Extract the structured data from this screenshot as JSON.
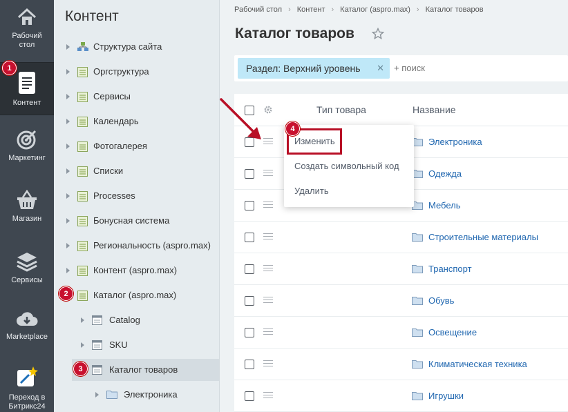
{
  "leftnav": {
    "items": [
      {
        "label": "Рабочий стол",
        "icon": "home-icon"
      },
      {
        "label": "Контент",
        "icon": "document-icon",
        "active": true
      },
      {
        "label": "Маркетинг",
        "icon": "target-icon"
      },
      {
        "label": "Магазин",
        "icon": "basket-icon"
      },
      {
        "label": "Сервисы",
        "icon": "layers-icon"
      },
      {
        "label": "Marketplace",
        "icon": "cloud-download-icon"
      },
      {
        "label": "Переход в Битрикс24",
        "icon": "magic-wand-icon"
      }
    ]
  },
  "badges": {
    "b1": "1",
    "b2": "2",
    "b3": "3",
    "b4": "4"
  },
  "tree": {
    "title": "Контент",
    "items": [
      {
        "label": "Структура сайта",
        "icon": "site-structure-icon"
      },
      {
        "label": "Оргструктура",
        "icon": "iblock-icon"
      },
      {
        "label": "Сервисы",
        "icon": "iblock-icon"
      },
      {
        "label": "Календарь",
        "icon": "iblock-icon"
      },
      {
        "label": "Фотогалерея",
        "icon": "iblock-icon"
      },
      {
        "label": "Списки",
        "icon": "iblock-icon"
      },
      {
        "label": "Processes",
        "icon": "iblock-icon"
      },
      {
        "label": "Бонусная система",
        "icon": "iblock-icon"
      },
      {
        "label": "Региональность (aspro.max)",
        "icon": "iblock-icon"
      },
      {
        "label": "Контент (aspro.max)",
        "icon": "iblock-icon"
      },
      {
        "label": "Каталог (aspro.max)",
        "icon": "iblock-icon"
      },
      {
        "label": "Catalog",
        "icon": "list-icon"
      },
      {
        "label": "SKU",
        "icon": "list-icon"
      },
      {
        "label": "Каталог товаров",
        "icon": "list-icon"
      },
      {
        "label": "Электроника",
        "icon": "folder-icon"
      }
    ]
  },
  "breadcrumbs": [
    "Рабочий стол",
    "Контент",
    "Каталог (aspro.max)",
    "Каталог товаров"
  ],
  "page": {
    "title": "Каталог товаров"
  },
  "filter": {
    "chip_label": "Раздел: Верхний уровень",
    "chip_close": "✕",
    "search_placeholder": "+ поиск"
  },
  "grid": {
    "columns": {
      "type": "Тип товара",
      "name": "Название"
    },
    "rows": [
      "Электроника",
      "Одежда",
      "Мебель",
      "Строительные материалы",
      "Транспорт",
      "Обувь",
      "Освещение",
      "Климатическая техника",
      "Игрушки"
    ]
  },
  "popup": {
    "items": [
      "Изменить",
      "Создать символьный код",
      "Удалить"
    ]
  },
  "colors": {
    "badge": "#c8102e",
    "link": "#2067b0",
    "chip": "#bfe8f8",
    "nav": "#3f4750"
  }
}
